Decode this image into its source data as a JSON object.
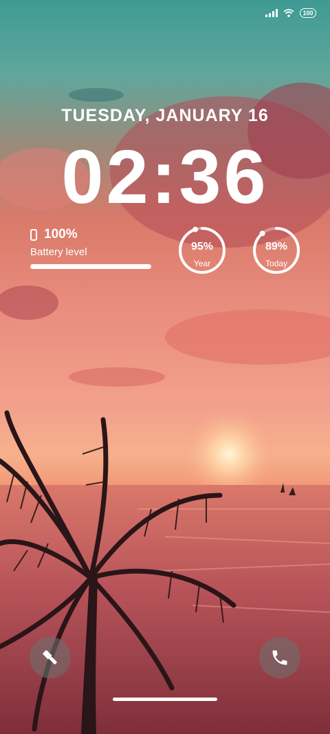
{
  "status_bar": {
    "signal_icon": "signal-bars-icon",
    "wifi_icon": "wifi-icon",
    "battery_value": "100"
  },
  "lockscreen": {
    "date": "TUESDAY, JANUARY 16",
    "time": "02:36"
  },
  "battery_widget": {
    "icon": "phone-icon",
    "percent_text": "100%",
    "label": "Battery level",
    "level": 1.0
  },
  "progress_rings": [
    {
      "value_text": "95%",
      "label": "Year",
      "fraction": 0.95
    },
    {
      "value_text": "89%",
      "label": "Today",
      "fraction": 0.89
    }
  ],
  "shortcuts": {
    "left_icon": "flashlight-icon",
    "right_icon": "phone-call-icon"
  },
  "colors": {
    "sky_top": "#3f9a94",
    "sunset": "#f2a08c",
    "sea": "#8f3c40"
  }
}
